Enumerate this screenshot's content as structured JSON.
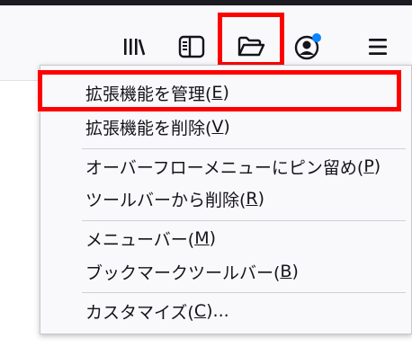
{
  "toolbar": {
    "icons": [
      "library-icon",
      "sidebar-icon",
      "folder-open-icon",
      "account-icon",
      "menu-icon"
    ],
    "badge_color": "#0a84ff",
    "highlight_color": "#ff0000"
  },
  "context_menu": {
    "items": [
      {
        "text": "拡張機能を管理(",
        "accel": "E",
        "close": ")"
      },
      {
        "text": "拡張機能を削除(",
        "accel": "V",
        "close": ")"
      },
      {
        "text": "オーバーフローメニューにピン留め(",
        "accel": "P",
        "close": ")"
      },
      {
        "text": "ツールバーから削除(",
        "accel": "R",
        "close": ")"
      },
      {
        "text": "メニューバー(",
        "accel": "M",
        "close": ")"
      },
      {
        "text": "ブックマークツールバー(",
        "accel": "B",
        "close": ")"
      },
      {
        "text": "カスタマイズ(",
        "accel": "C",
        "close": ")..."
      }
    ]
  }
}
